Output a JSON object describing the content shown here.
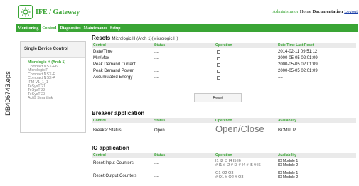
{
  "side_label": "DB406743.eps",
  "header": {
    "app_title": "IFE / Gateway",
    "links": {
      "administrator": "Administrator",
      "home": "Home",
      "documentation": "Documentation",
      "logout": "Logout"
    }
  },
  "nav": {
    "tabs": [
      "Monitoring",
      "Control",
      "Diagnostics",
      "Maintenance",
      "Setup"
    ],
    "active": "Control"
  },
  "left_panel": {
    "title": "Single Device Control",
    "devices": [
      "Micrologic H (Arch 1)",
      "Compact NSX-E6",
      "Micrologic P",
      "Compact NSX-E",
      "Compact NSX-A",
      "IFM V1_1_1",
      "TeSysT 21",
      "TeSysT 22",
      "TeSysT 23",
      "Acti9 Smartlink"
    ],
    "selected_index": 0
  },
  "resets": {
    "title": "Resets",
    "subtitle": "Micrologic H (Arch 1)(Micrologic H)",
    "columns": [
      "Control",
      "Status",
      "Operation",
      "Date/Time Last Reset"
    ],
    "rows": [
      {
        "control": "Date/Time",
        "status": "----",
        "datetime": "2014-02-11 09:51:12"
      },
      {
        "control": "Min/Max",
        "status": "----",
        "datetime": "2000-05-05 02:01:09"
      },
      {
        "control": "Peak Demand Current",
        "status": "----",
        "datetime": "2000-05-05 02:01:09"
      },
      {
        "control": "Peak Demand Power",
        "status": "----",
        "datetime": "2000-05-05 02:01:09"
      },
      {
        "control": "Accumulated Energy",
        "status": "----",
        "datetime": "----"
      }
    ],
    "reset_button": "Reset"
  },
  "breaker": {
    "title": "Breaker application",
    "columns": [
      "Control",
      "Status",
      "Operation",
      "Availability"
    ],
    "row": {
      "control": "Breaker Status",
      "status": "Open",
      "open": "Open",
      "sep": "/",
      "close": "Close",
      "availability": "BCMULP"
    }
  },
  "io": {
    "title": "IO application",
    "columns": [
      "Control",
      "Status",
      "Operation",
      "Availability"
    ],
    "rows": [
      {
        "control": "Reset Input Counters",
        "status": "----",
        "op_line1": "I1  I2  I3  I4  I5  I6",
        "op_line2": "# I1  # I2  # I3  # I4  # I5  # I6",
        "avail_line1": "IO Module 1",
        "avail_line2": "IO Module 2"
      },
      {
        "control": "Reset Output Counters",
        "status": "----",
        "op_line1": "O1  O2  O3",
        "op_line2": "# O1  # O2  # O3",
        "avail_line1": "IO Module 1",
        "avail_line2": "IO Module 2"
      }
    ]
  },
  "colors": {
    "accent": "#3aa535",
    "header_row": "#eaeaea",
    "link": "#1a3fa8"
  },
  "icons": {
    "logo": "gear-icon"
  }
}
